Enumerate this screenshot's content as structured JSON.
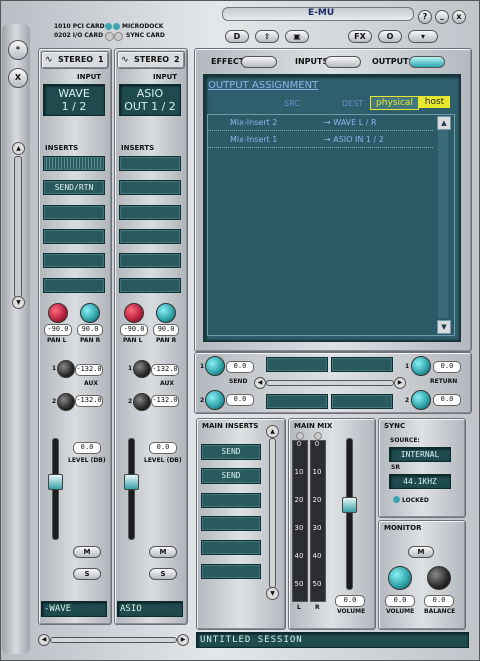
{
  "header": {
    "card_1010": "1010 PCI CARD",
    "card_0202": "0202 I/O CARD",
    "microdock": "MICRODOCK",
    "sync_card": "SYNC CARD",
    "logo": "E-MU",
    "help": "?",
    "minimize": "_",
    "close": "x",
    "toolbar": [
      "D",
      "⇧",
      "▣",
      "FX",
      "O",
      "▾"
    ]
  },
  "side": {
    "btn1": "*",
    "btn2": "X"
  },
  "strips": [
    {
      "name": "STEREO",
      "num": "1",
      "input_label": "INPUT",
      "input": [
        "WAVE",
        "1 / 2"
      ],
      "inserts_label": "INSERTS",
      "inserts": [
        "",
        "SEND/RTN",
        "",
        "",
        "",
        ""
      ],
      "pan_l": "-90.0",
      "pan_r": "90.0",
      "pan_l_label": "PAN L",
      "pan_r_label": "PAN R",
      "aux_label": "AUX",
      "aux1": "-132.0",
      "aux2": "-132.0",
      "level": "0.0",
      "level_label": "LEVEL (DB)",
      "m": "M",
      "s": "S",
      "bottom": "-WAVE"
    },
    {
      "name": "STEREO",
      "num": "2",
      "input_label": "INPUT",
      "input": [
        "ASIO",
        "OUT 1 / 2"
      ],
      "inserts_label": "INSERTS",
      "inserts": [
        "",
        "",
        "",
        "",
        "",
        ""
      ],
      "pan_l": "-90.0",
      "pan_r": "90.0",
      "pan_l_label": "PAN L",
      "pan_r_label": "PAN R",
      "aux_label": "AUX",
      "aux1": "-132.0",
      "aux2": "-132.0",
      "level": "0.0",
      "level_label": "LEVEL (DB)",
      "m": "M",
      "s": "S",
      "bottom": "ASIO"
    }
  ],
  "tabs": {
    "effect": "EFFECT",
    "inputs": "INPUTS",
    "outputs": "OUTPUTS"
  },
  "output": {
    "title": "OUTPUT ASSIGNMENT",
    "src": "SRC",
    "dest": "DEST",
    "physical": "physical",
    "host": "host",
    "rows": [
      {
        "src": "Mix-Insert 2",
        "dest": "→ WAVE L / R"
      },
      {
        "src": "Mix-Insert 1",
        "dest": "→ ASIO IN 1 / 2"
      }
    ]
  },
  "sends": {
    "send1": "0.0",
    "send2": "0.0",
    "send_label": "SEND",
    "return1": "0.0",
    "return2": "0.0",
    "return_label": "RETURN",
    "num1": "1",
    "num2": "2"
  },
  "main_inserts": {
    "title": "MAIN INSERTS",
    "slots": [
      "SEND",
      "SEND",
      "",
      "",
      "",
      ""
    ]
  },
  "main_mix": {
    "title": "MAIN MIX",
    "scale": [
      "0",
      "10",
      "20",
      "30",
      "40",
      "50"
    ],
    "l": "L",
    "r": "R",
    "volume": "0.0",
    "volume_label": "VOLUME"
  },
  "sync": {
    "title": "SYNC",
    "source_label": "SOURCE:",
    "source": "INTERNAL",
    "sr_label": "SR",
    "sr": "44.1KHZ",
    "locked": "LOCKED"
  },
  "monitor": {
    "title": "MONITOR",
    "m": "M",
    "volume": "0.0",
    "balance": "0.0",
    "volume_label": "VOLUME",
    "balance_label": "BALANCE"
  },
  "session": "UNTITLED SESSION",
  "colors": {
    "lcd": "#1f4a4e",
    "teal": "#2b9fa5",
    "highlight": "#e8e82e",
    "red_knob": "#b3203a"
  }
}
